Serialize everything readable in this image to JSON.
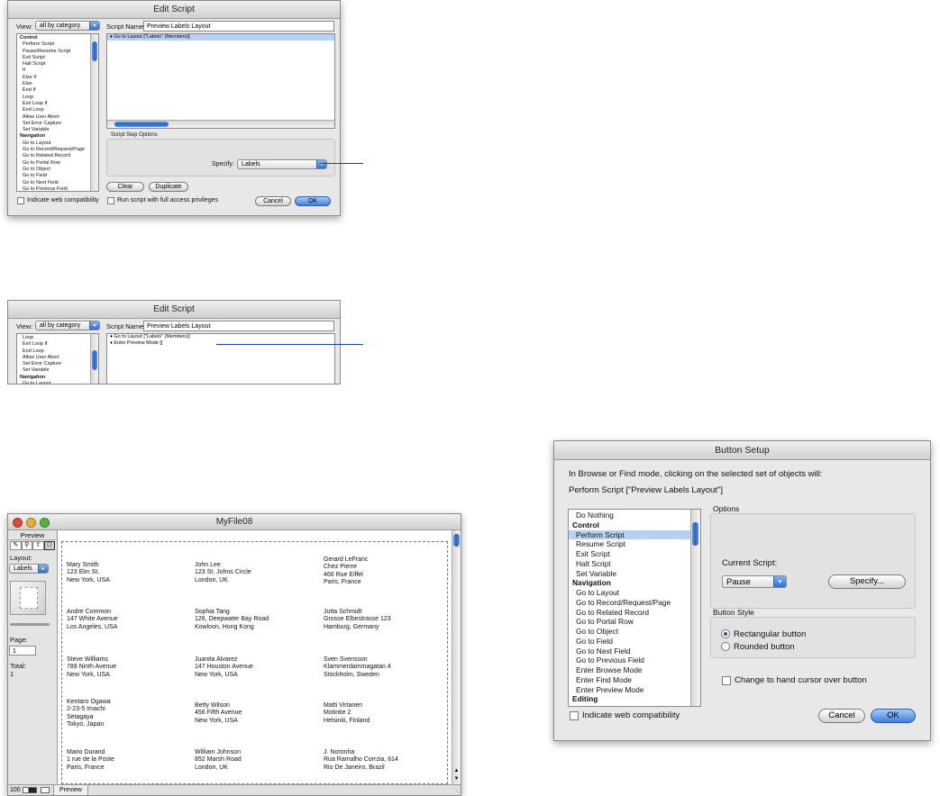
{
  "edit_script_1": {
    "title": "Edit Script",
    "view_label": "View:",
    "view_value": "all by category",
    "script_name_label": "Script Name:",
    "script_name_value": "Preview Labels Layout",
    "steps": [
      {
        "label": "Control",
        "cat": true
      },
      {
        "label": "Perform Script"
      },
      {
        "label": "Pause/Resume Script"
      },
      {
        "label": "Exit Script"
      },
      {
        "label": "Halt Script"
      },
      {
        "label": "If"
      },
      {
        "label": "Else If"
      },
      {
        "label": "Else"
      },
      {
        "label": "End If"
      },
      {
        "label": "Loop"
      },
      {
        "label": "Exit Loop If"
      },
      {
        "label": "End Loop"
      },
      {
        "label": "Allow User Abort"
      },
      {
        "label": "Set Error Capture"
      },
      {
        "label": "Set Variable"
      },
      {
        "label": "Navigation",
        "cat": true
      },
      {
        "label": "Go to Layout"
      },
      {
        "label": "Go to Record/Request/Page"
      },
      {
        "label": "Go to Related Record"
      },
      {
        "label": "Go to Portal Row"
      },
      {
        "label": "Go to Object"
      },
      {
        "label": "Go to Field"
      },
      {
        "label": "Go to Next Field"
      },
      {
        "label": "Go to Previous Field"
      }
    ],
    "script_lines": [
      "Go to Layout [\"Labels\" (Members)]"
    ],
    "options_label": "Script Step Options",
    "specify_label": "Specify:",
    "specify_value": "Labels",
    "clear_label": "Clear",
    "duplicate_label": "Duplicate",
    "web_compat_label": "Indicate web compatibility",
    "full_access_label": "Run script with full access privileges",
    "cancel_label": "Cancel",
    "ok_label": "OK"
  },
  "edit_script_2": {
    "title": "Edit Script",
    "view_label": "View:",
    "view_value": "all by category",
    "script_name_label": "Script Name:",
    "script_name_value": "Preview Labels Layout",
    "steps": [
      {
        "label": "Loop"
      },
      {
        "label": "Exit Loop If"
      },
      {
        "label": "End Loop"
      },
      {
        "label": "Allow User Abort"
      },
      {
        "label": "Set Error Capture"
      },
      {
        "label": "Set Variable"
      },
      {
        "label": "Navigation",
        "cat": true
      },
      {
        "label": "Go to Layout"
      }
    ],
    "script_lines": [
      "Go to Layout [\"Labels\" (Members)]",
      "Enter Preview Mode []"
    ]
  },
  "button_setup": {
    "title": "Button Setup",
    "intro": "In Browse or Find mode, clicking on the selected set of objects will:",
    "action": "Perform Script [\"Preview Labels Layout\"]",
    "steps": [
      {
        "label": "Do Nothing"
      },
      {
        "label": "Control",
        "cat": true
      },
      {
        "label": "Perform Script",
        "sel": true
      },
      {
        "label": "Resume Script"
      },
      {
        "label": "Exit Script"
      },
      {
        "label": "Halt Script"
      },
      {
        "label": "Set Variable"
      },
      {
        "label": "Navigation",
        "cat": true
      },
      {
        "label": "Go to Layout"
      },
      {
        "label": "Go to Record/Request/Page"
      },
      {
        "label": "Go to Related Record"
      },
      {
        "label": "Go to Portal Row"
      },
      {
        "label": "Go to Object"
      },
      {
        "label": "Go to Field"
      },
      {
        "label": "Go to Next Field"
      },
      {
        "label": "Go to Previous Field"
      },
      {
        "label": "Enter Browse Mode"
      },
      {
        "label": "Enter Find Mode"
      },
      {
        "label": "Enter Preview Mode"
      },
      {
        "label": "Editing",
        "cat": true
      }
    ],
    "options_label": "Options",
    "current_script_label": "Current Script:",
    "current_script_value": "Pause",
    "specify_label": "Specify...",
    "button_style_label": "Button Style",
    "rect_label": "Rectangular button",
    "rounded_label": "Rounded button",
    "hand_cursor_label": "Change to hand cursor over button",
    "web_compat_label": "Indicate web compatibility",
    "cancel_label": "Cancel",
    "ok_label": "OK"
  },
  "myfile": {
    "title": "MyFile08",
    "mode_label": "Preview",
    "layout_label": "Layout:",
    "layout_value": "Labels",
    "page_label": "Page:",
    "page_value": "1",
    "total_label": "Total:",
    "total_value": "1",
    "zoom": "100",
    "status_mode": "Preview",
    "records": [
      [
        "Mary Smith",
        "123 Elm St.",
        "New York, USA"
      ],
      [
        "John Lee",
        "123 St. Johns Circle",
        "London, UK"
      ],
      [
        "Gerard LeFranc",
        "Chez Pierre",
        "466 Rue Eiffel",
        "Paris, France"
      ],
      [
        "Andre Common",
        "147 White Avenue",
        "Los Angeles, USA"
      ],
      [
        "Sophia Tang",
        "126, Deepwater Bay Road",
        "Kowloon, Hong Kong"
      ],
      [
        "Jutta Schmidt",
        "Grosse Elbestrasse 123",
        "Hamburg, Germany"
      ],
      [
        "Steve Williams",
        "789 Ninth Avenue",
        "New York, USA"
      ],
      [
        "Juanita Alvarez",
        "147 Houston Avenue",
        "New York, USA"
      ],
      [
        "Sven Svensson",
        "Klammerdammagatan 4",
        "Stockholm, Sweden"
      ],
      [
        "Kentaro Ogawa",
        "2-23-5 Imachi",
        "Setagaya",
        "Tokyo, Japan"
      ],
      [
        "Betty Wilson",
        "456 Fifth Avenue",
        "New York, USA"
      ],
      [
        "Matti Virtanen",
        "Motintie 2",
        "Helsinki, Finland"
      ],
      [
        "Mario Durand",
        "1 rue de la Poste",
        "Paris, France"
      ],
      [
        "William Johnson",
        "852 Marsh Road",
        "London, UK"
      ],
      [
        "J. Noronha",
        "Rua Ramalho Corrzia, 614",
        "Rio De Janeiro, Brazil"
      ]
    ]
  }
}
